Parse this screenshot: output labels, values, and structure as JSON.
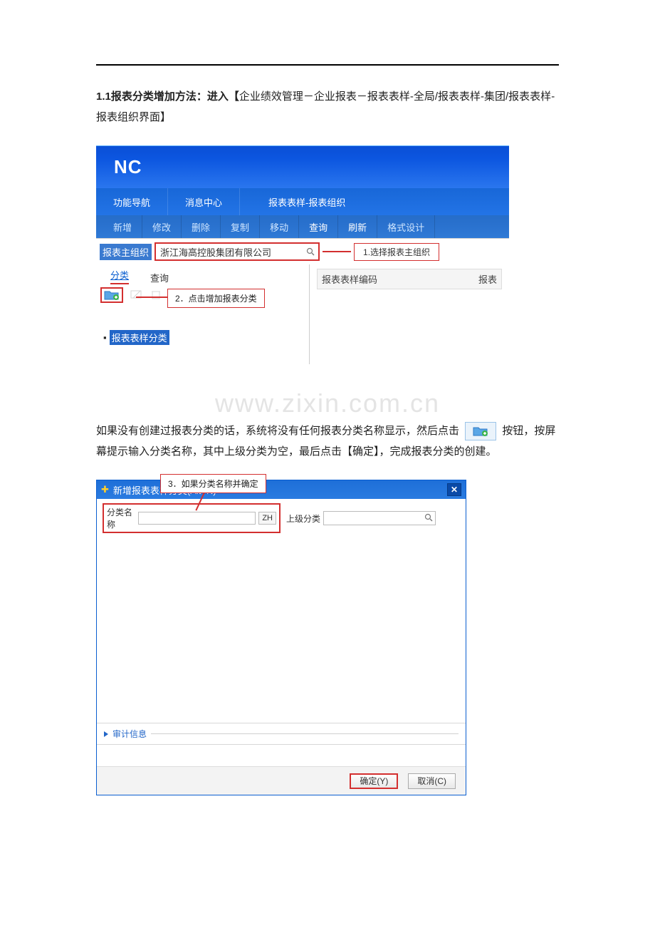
{
  "doc": {
    "title_bold": "1.1报表分类增加方法：进入【",
    "title_rest": "企业绩效管理－企业报表－报表表样-全局/报表表样-集团/报表表样-报表组织界面】",
    "para2_a": "如果没有创建过报表分类的话，系统将没有任何报表分类名称显示，然后点击",
    "para2_b": "按钮，按屏幕提示输入分类名称，其中上级分类为空，最后点击【确定】，完成报表分类的创建。"
  },
  "watermark": "www.zixin.com.cn",
  "shot1": {
    "logo": "NC",
    "tabs": {
      "a": "功能导航",
      "b": "消息中心",
      "c": "报表表样-报表组织"
    },
    "toolbar": {
      "a": "新增",
      "b": "修改",
      "c": "删除",
      "d": "复制",
      "e": "移动",
      "f": "查询",
      "g": "刷新",
      "h": "格式设计"
    },
    "org_label": "报表主组织",
    "org_value": "浙江海高控股集团有限公司",
    "callout1": "1.选择报表主组织",
    "subtabs": {
      "a": "分类",
      "b": "查询"
    },
    "callout2": "2．点击增加报表分类",
    "tree_item": "报表表样分类",
    "rhead": {
      "a": "报表表样编码",
      "b": "报表"
    }
  },
  "callout3": "3．如果分类名称并确定",
  "dialog": {
    "title": "新增报表表样分类(Alt+N)",
    "label1": "分类名称",
    "zh": "ZH",
    "label2": "上级分类",
    "expand": "审计信息",
    "ok": "确定(Y)",
    "cancel": "取消(C)"
  }
}
